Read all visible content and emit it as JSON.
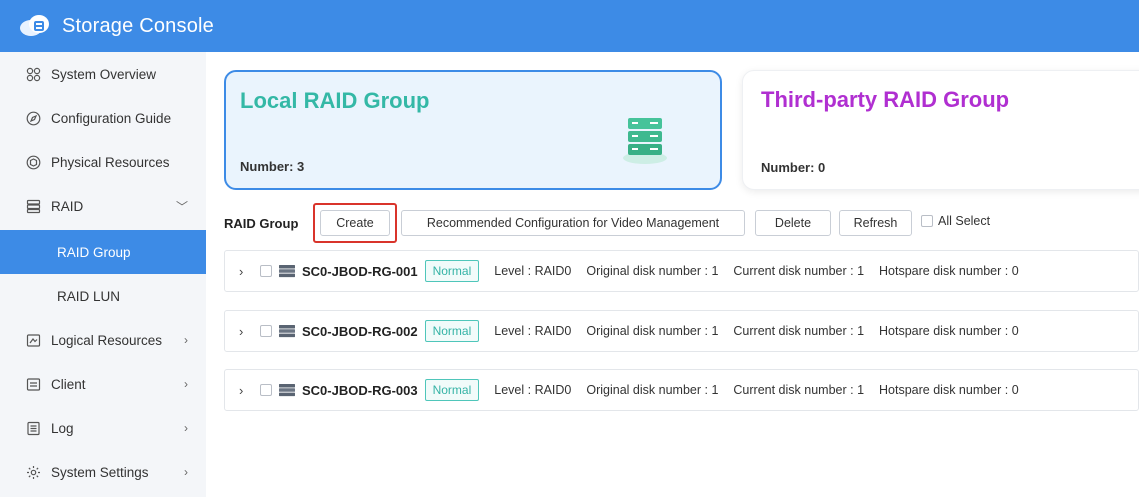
{
  "header": {
    "title": "Storage Console"
  },
  "sidebar": {
    "items": [
      {
        "label": "System Overview",
        "icon": "grid-icon"
      },
      {
        "label": "Configuration Guide",
        "icon": "compass-icon"
      },
      {
        "label": "Physical Resources",
        "icon": "box-icon"
      },
      {
        "label": "RAID",
        "icon": "server-icon",
        "arrow": "﹀"
      },
      {
        "label": "RAID Group"
      },
      {
        "label": "RAID LUN"
      },
      {
        "label": "Logical Resources",
        "icon": "logical-icon",
        "arrow": "›"
      },
      {
        "label": "Client",
        "icon": "client-icon",
        "arrow": "›"
      },
      {
        "label": "Log",
        "icon": "log-icon",
        "arrow": "›"
      },
      {
        "label": "System Settings",
        "icon": "gear-icon",
        "arrow": "›"
      }
    ],
    "active": "RAID Group"
  },
  "cards": {
    "local": {
      "title": "Local RAID Group",
      "number_label": "Number: 3"
    },
    "third": {
      "title": "Third-party RAID Group",
      "number_label": "Number: 0"
    }
  },
  "toolbar": {
    "label": "RAID Group",
    "create": "Create",
    "recommended": "Recommended Configuration for Video Management",
    "delete": "Delete",
    "refresh": "Refresh",
    "all_select": "All Select"
  },
  "raid_groups": [
    {
      "name": "SC0-JBOD-RG-001",
      "status": "Normal",
      "level": "Level : RAID0",
      "original": "Original disk number : 1",
      "current": "Current disk number : 1",
      "hotspare": "Hotspare disk number : 0"
    },
    {
      "name": "SC0-JBOD-RG-002",
      "status": "Normal",
      "level": "Level : RAID0",
      "original": "Original disk number : 1",
      "current": "Current disk number : 1",
      "hotspare": "Hotspare disk number : 0"
    },
    {
      "name": "SC0-JBOD-RG-003",
      "status": "Normal",
      "level": "Level : RAID0",
      "original": "Original disk number : 1",
      "current": "Current disk number : 1",
      "hotspare": "Hotspare disk number : 0"
    }
  ],
  "colors": {
    "primary": "#3d8be6",
    "local_title": "#34b8a6",
    "third_title": "#b02fd1",
    "normal_badge": "#4fc6ba",
    "highlight": "#d9342b"
  }
}
